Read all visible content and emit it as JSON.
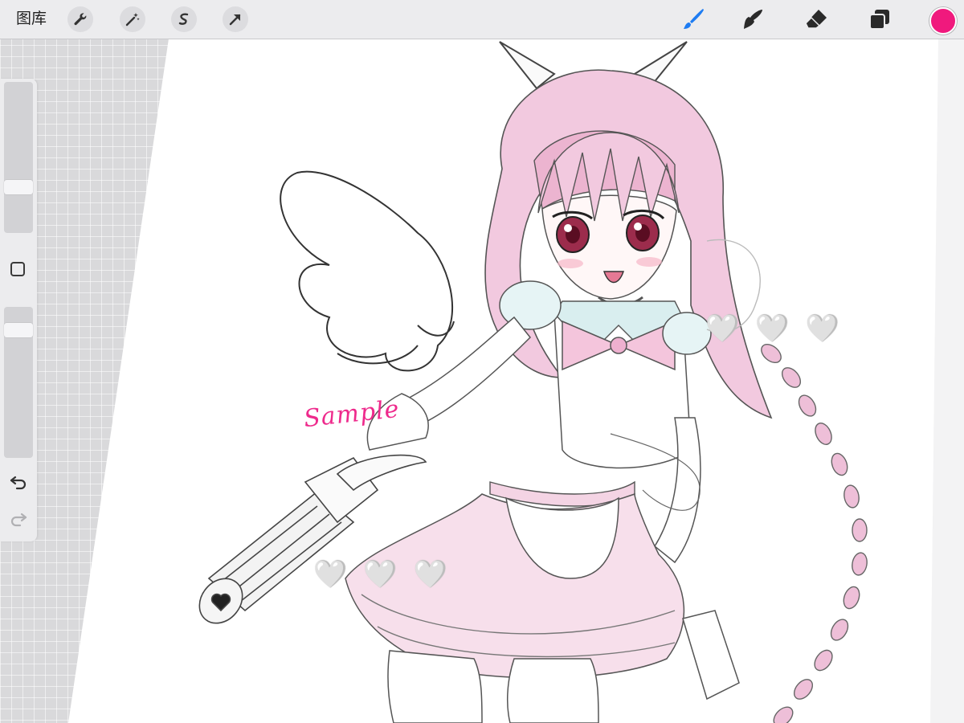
{
  "toolbar": {
    "gallery_label": "图库",
    "left_tools": [
      "wrench-icon",
      "magic-wand-icon",
      "selection-icon",
      "transform-arrow-icon"
    ],
    "right_tools": [
      "brush-icon",
      "smudge-icon",
      "eraser-icon",
      "layers-icon"
    ],
    "active_tool": "brush-icon",
    "current_color": "#f0197d",
    "accent_color": "#1e7cf2"
  },
  "sidebar": {
    "brush_size_level": 0.28,
    "opacity_level": 0.88,
    "icons": [
      "modify-square-icon",
      "undo-icon",
      "redo-icon"
    ]
  },
  "canvas": {
    "artwork_text": "Sample",
    "hearts": [
      "🤍",
      "🤍",
      "🤍"
    ]
  }
}
